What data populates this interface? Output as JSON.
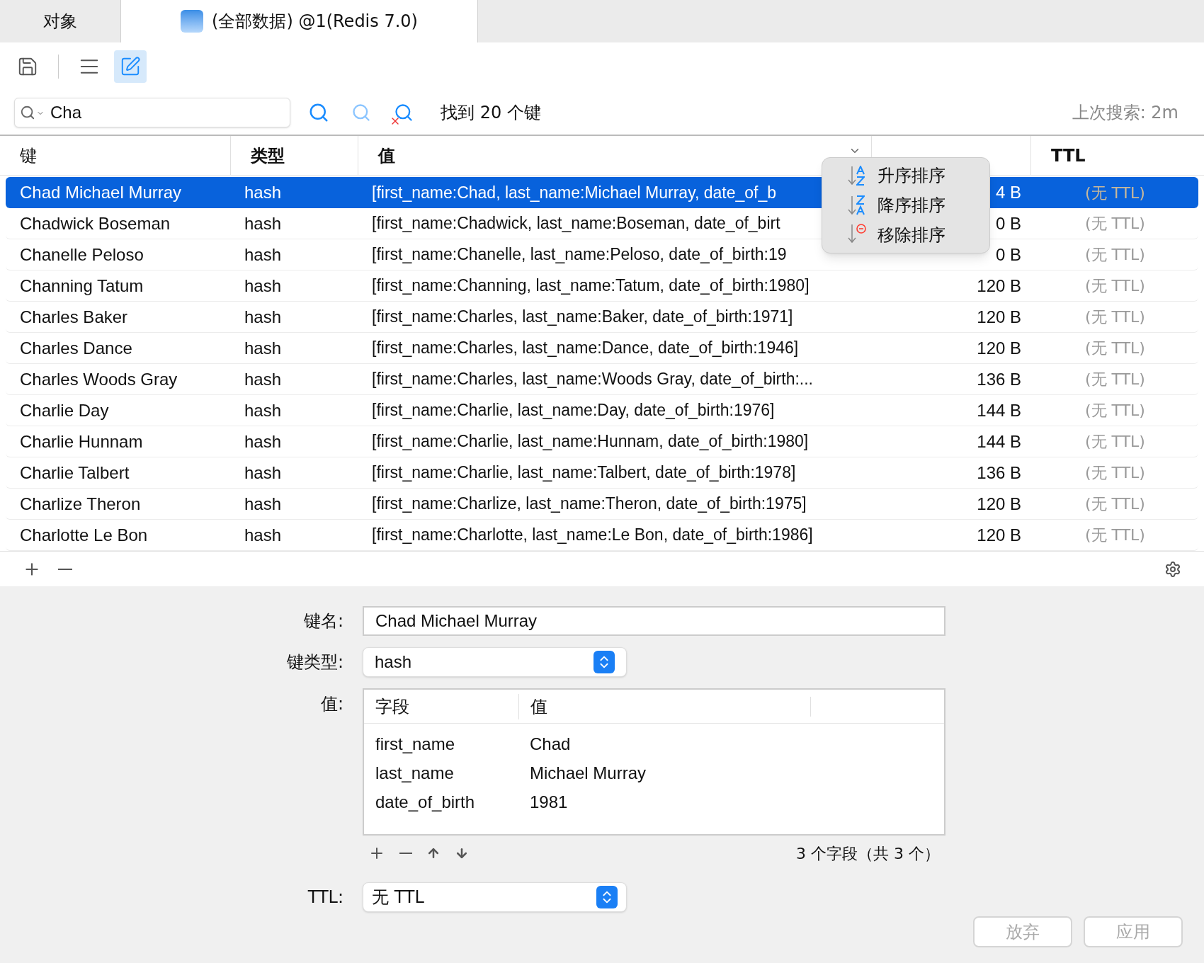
{
  "tabs": [
    {
      "label": "对象",
      "selected": false
    },
    {
      "label": "(全部数据) @1(Redis 7.0)",
      "selected": true
    }
  ],
  "toolbar": [
    {
      "kind": "save",
      "selected": false
    },
    {
      "kind": "list",
      "selected": false
    },
    {
      "kind": "edit",
      "selected": true
    }
  ],
  "search": {
    "value": "Cha",
    "result": "找到 20 个键",
    "last_search": "上次搜索: 2m"
  },
  "table": {
    "columns": [
      {
        "label": "键",
        "sorted": false
      },
      {
        "label": "类型",
        "sorted": false
      },
      {
        "label": "值",
        "sorted": true
      },
      {
        "sorted": false
      },
      {
        "label": "TTL",
        "sorted": false
      }
    ],
    "rows": [
      {
        "key": "Chad Michael Murray",
        "type": "hash",
        "value": "[first_name:Chad, last_name:Michael Murray, date_of_b",
        "size": "4 B",
        "ttl": "(无 TTL)",
        "selected": true
      },
      {
        "key": "Chadwick Boseman",
        "type": "hash",
        "value": "[first_name:Chadwick, last_name:Boseman, date_of_birt",
        "size": "0 B",
        "ttl": "(无 TTL)",
        "selected": false
      },
      {
        "key": "Chanelle Peloso",
        "type": "hash",
        "value": "[first_name:Chanelle, last_name:Peloso, date_of_birth:19",
        "size": "0 B",
        "ttl": "(无 TTL)",
        "selected": false
      },
      {
        "key": "Channing Tatum",
        "type": "hash",
        "value": "[first_name:Channing, last_name:Tatum, date_of_birth:1980]",
        "size": "120 B",
        "ttl": "(无 TTL)",
        "selected": false
      },
      {
        "key": "Charles Baker",
        "type": "hash",
        "value": "[first_name:Charles, last_name:Baker, date_of_birth:1971]",
        "size": "120 B",
        "ttl": "(无 TTL)",
        "selected": false
      },
      {
        "key": "Charles Dance",
        "type": "hash",
        "value": "[first_name:Charles, last_name:Dance, date_of_birth:1946]",
        "size": "120 B",
        "ttl": "(无 TTL)",
        "selected": false
      },
      {
        "key": "Charles Woods Gray",
        "type": "hash",
        "value": "[first_name:Charles, last_name:Woods Gray, date_of_birth:...",
        "size": "136 B",
        "ttl": "(无 TTL)",
        "selected": false
      },
      {
        "key": "Charlie Day",
        "type": "hash",
        "value": "[first_name:Charlie, last_name:Day, date_of_birth:1976]",
        "size": "144 B",
        "ttl": "(无 TTL)",
        "selected": false
      },
      {
        "key": "Charlie Hunnam",
        "type": "hash",
        "value": "[first_name:Charlie, last_name:Hunnam, date_of_birth:1980]",
        "size": "144 B",
        "ttl": "(无 TTL)",
        "selected": false
      },
      {
        "key": "Charlie Talbert",
        "type": "hash",
        "value": "[first_name:Charlie, last_name:Talbert, date_of_birth:1978]",
        "size": "136 B",
        "ttl": "(无 TTL)",
        "selected": false
      },
      {
        "key": "Charlize Theron",
        "type": "hash",
        "value": "[first_name:Charlize, last_name:Theron, date_of_birth:1975]",
        "size": "120 B",
        "ttl": "(无 TTL)",
        "selected": false
      },
      {
        "key": "Charlotte Le Bon",
        "type": "hash",
        "value": "[first_name:Charlotte, last_name:Le Bon, date_of_birth:1986]",
        "size": "120 B",
        "ttl": "(无 TTL)",
        "selected": false
      }
    ]
  },
  "sort_menu": [
    {
      "kind": "asc",
      "label": "升序排序"
    },
    {
      "kind": "desc",
      "label": "降序排序"
    },
    {
      "kind": "remove",
      "label": "移除排序"
    }
  ],
  "form": {
    "key_name_label": "键名:",
    "key_name": "Chad Michael Murray",
    "key_type_label": "键类型:",
    "key_type": "hash",
    "value_label": "值:",
    "fields": {
      "columns": [
        "字段",
        "值"
      ],
      "rows": [
        [
          "first_name",
          "Chad"
        ],
        [
          "last_name",
          "Michael Murray"
        ],
        [
          "date_of_birth",
          "1981"
        ]
      ],
      "count": "3 个字段（共 3 个）"
    },
    "ttl_label": "TTL:",
    "ttl": "无 TTL"
  },
  "buttons": [
    {
      "label": "放弃",
      "disabled": true
    },
    {
      "label": "应用",
      "disabled": true
    }
  ]
}
